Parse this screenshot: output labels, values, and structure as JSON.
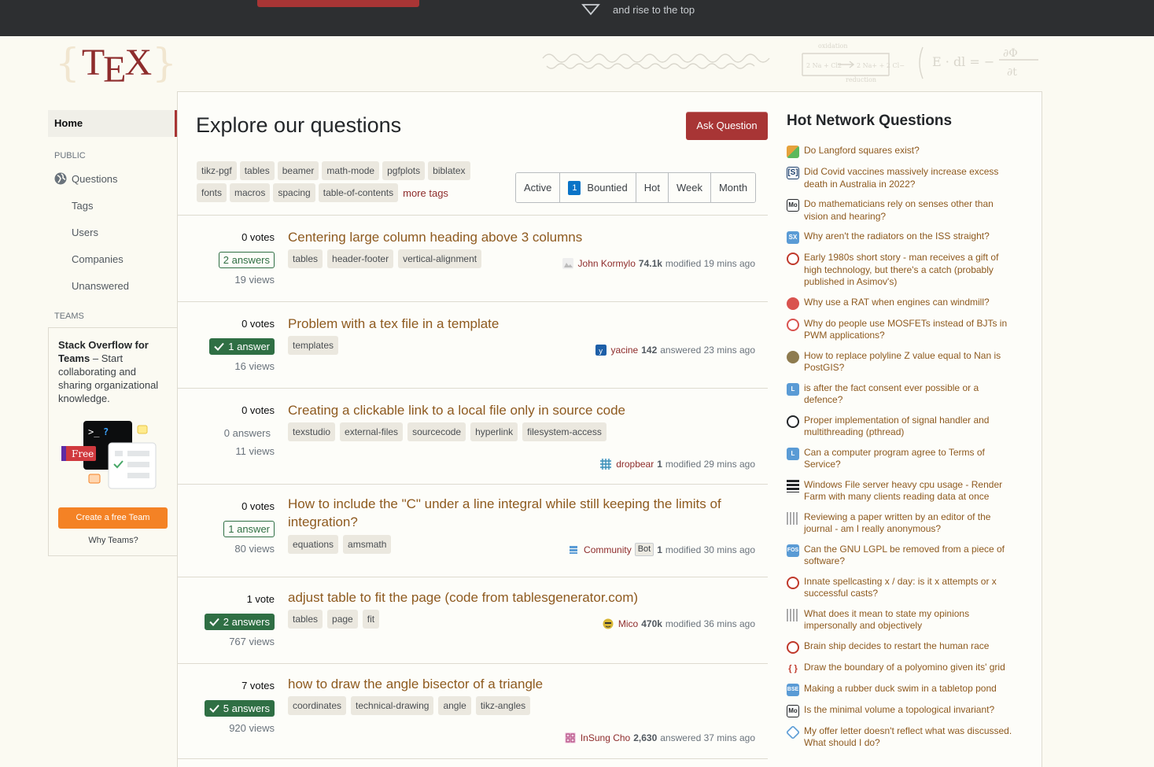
{
  "topbar": {
    "rise_text": "and rise to the top"
  },
  "logo": {
    "text_t": "T",
    "text_e": "E",
    "text_x": "X"
  },
  "nav": {
    "home": "Home",
    "public_label": "PUBLIC",
    "questions": "Questions",
    "tags": "Tags",
    "users": "Users",
    "companies": "Companies",
    "unanswered": "Unanswered",
    "teams_label": "TEAMS"
  },
  "teams": {
    "headline": "Stack Overflow for Teams",
    "body": " – Start collaborating and sharing organizational knowledge.",
    "free_badge": "Free",
    "cta": "Create a free Team",
    "why": "Why Teams?"
  },
  "main": {
    "title": "Explore our questions",
    "ask_button": "Ask Question",
    "tag_row1": [
      "tikz-pgf",
      "tables",
      "beamer",
      "math-mode",
      "pgfplots",
      "biblatex"
    ],
    "tag_row2": [
      "fonts",
      "macros",
      "spacing",
      "table-of-contents"
    ],
    "more_tags": "more tags",
    "filters": {
      "active": "Active",
      "bountied_count": "1",
      "bountied": "Bountied",
      "hot": "Hot",
      "week": "Week",
      "month": "Month"
    }
  },
  "questions": [
    {
      "votes": "0 votes",
      "answers": "2 answers",
      "views": "19 views",
      "title": "Centering large column heading above 3 columns",
      "tags": [
        "tables",
        "header-footer",
        "vertical-alignment"
      ],
      "user": "John Kormylo",
      "rep": "74.1k",
      "action": "modified 19 mins ago"
    },
    {
      "votes": "0 votes",
      "answers": "1 answer",
      "views": "16 views",
      "title": "Problem with a tex file in a template",
      "tags": [
        "templates"
      ],
      "user": "yacine",
      "rep": "142",
      "action": "answered 23 mins ago"
    },
    {
      "votes": "0 votes",
      "answers": "0 answers",
      "views": "11 views",
      "title": "Creating a clickable link to a local file only in source code",
      "tags": [
        "texstudio",
        "external-files",
        "sourcecode",
        "hyperlink",
        "filesystem-access"
      ],
      "user": "dropbear",
      "rep": "1",
      "action": "modified 29 mins ago"
    },
    {
      "votes": "0 votes",
      "answers": "1 answer",
      "views": "80 views",
      "title": "How to include the \"C\" under a line integral while still keeping the limits of integration?",
      "tags": [
        "equations",
        "amsmath"
      ],
      "user": "Community",
      "bot": "Bot",
      "rep": "1",
      "action": "modified 30 mins ago"
    },
    {
      "votes": "1 vote",
      "answers": "2 answers",
      "views": "767 views",
      "title": "adjust table to fit the page (code from tablesgenerator.com)",
      "tags": [
        "tables",
        "page",
        "fit"
      ],
      "user": "Mico",
      "rep": "470k",
      "action": "modified 36 mins ago"
    },
    {
      "votes": "7 votes",
      "answers": "5 answers",
      "views": "920 views",
      "title": "how to draw the angle bisector of a triangle",
      "tags": [
        "coordinates",
        "technical-drawing",
        "angle",
        "tikz-angles"
      ],
      "user": "InSung Cho",
      "rep": "2,630",
      "action": "answered 37 mins ago"
    }
  ],
  "hot": {
    "title": "Hot Network Questions",
    "items": [
      {
        "text": "Do Langford squares exist?",
        "icon": "puzzling-icon",
        "color": "#e6a23c"
      },
      {
        "text": "Did Covid vaccines massively increase excess death in Australia in 2022?",
        "icon": "skeptics-icon",
        "color": "#ffffff"
      },
      {
        "text": "Do mathematicians rely on senses other than vision and hearing?",
        "icon": "mathoverflow-icon",
        "color": "#ffffff"
      },
      {
        "text": "Why aren't the radiators on the ISS straight?",
        "icon": "space-icon",
        "color": "#5a9bd5"
      },
      {
        "text": "Early 1980s short story - man receives a gift of high technology, but there's a catch (probably published in Asimov's)",
        "icon": "scifi-icon",
        "color": "#c0392b"
      },
      {
        "text": "Why use a RAT when engines can windmill?",
        "icon": "aviation-icon",
        "color": "#d9534f"
      },
      {
        "text": "Why do people use MOSFETs instead of BJTs in PWM applications?",
        "icon": "electronics-icon",
        "color": "#d9534f"
      },
      {
        "text": "How to replace polyline Z value equal to Nan is PostGIS?",
        "icon": "gis-icon",
        "color": "#8e7b4f"
      },
      {
        "text": "is after the fact consent ever possible or a defence?",
        "icon": "law-icon",
        "color": "#5a9bd5"
      },
      {
        "text": "Proper implementation of signal handler and multithreading (pthread)",
        "icon": "codereview-icon",
        "color": "#ffffff"
      },
      {
        "text": "Can a computer program agree to Terms of Service?",
        "icon": "law-icon",
        "color": "#5a9bd5"
      },
      {
        "text": "Windows File server heavy cpu usage - Render Farm with many clients reading data at once",
        "icon": "serverfault-icon",
        "color": "#232629"
      },
      {
        "text": "Reviewing a paper written by an editor of the journal - am I really anonymous?",
        "icon": "academia-icon",
        "color": "#aaaaaa"
      },
      {
        "text": "Can the GNU LGPL be removed from a piece of software?",
        "icon": "opensource-icon",
        "color": "#5a9bd5"
      },
      {
        "text": "Innate spellcasting x / day: is it x attempts or x successful casts?",
        "icon": "rpg-icon",
        "color": "#c0392b"
      },
      {
        "text": "What does it mean to state my opinions impersonally and objectively",
        "icon": "writing-icon",
        "color": "#aaaaaa"
      },
      {
        "text": "Brain ship decides to restart the human race",
        "icon": "scifi-icon",
        "color": "#c0392b"
      },
      {
        "text": "Draw the boundary of a polyomino given its' grid",
        "icon": "codegolf-icon",
        "color": "#ffffff"
      },
      {
        "text": "Making a rubber duck swim in a tabletop pond",
        "icon": "blender-icon",
        "color": "#5a9bd5"
      },
      {
        "text": "Is the minimal volume a topological invariant?",
        "icon": "mathoverflow-icon",
        "color": "#ffffff"
      },
      {
        "text": "My offer letter doesn't reflect what was discussed. What should I do?",
        "icon": "workplace-icon",
        "color": "#5a9bd5"
      }
    ]
  }
}
